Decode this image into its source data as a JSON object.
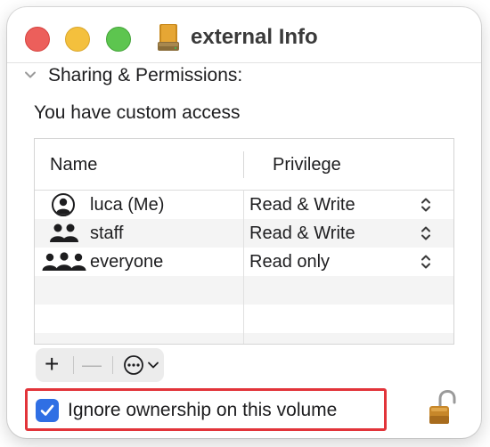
{
  "window": {
    "title": "external Info"
  },
  "sharing": {
    "section_label": "Sharing & Permissions:",
    "access_text": "You have custom access"
  },
  "table": {
    "columns": [
      "Name",
      "Privilege"
    ],
    "rows": [
      {
        "name": "luca (Me)",
        "privilege": "Read & Write",
        "icon": "user-icon"
      },
      {
        "name": "staff",
        "privilege": "Read & Write",
        "icon": "group-icon"
      },
      {
        "name": "everyone",
        "privilege": "Read only",
        "icon": "everyone-icon"
      }
    ]
  },
  "toolbar": {
    "add_label": "+",
    "remove_label": "—",
    "more_icon": "ellipsis-circle-icon"
  },
  "options": {
    "ignore_ownership_label": "Ignore ownership on this volume",
    "ignore_ownership_checked": true
  },
  "colors": {
    "close": "#ec5f5b",
    "minimize": "#f4c03d",
    "maximize": "#5dc54f",
    "accent": "#2f6fe4",
    "highlight": "#e2343a"
  }
}
